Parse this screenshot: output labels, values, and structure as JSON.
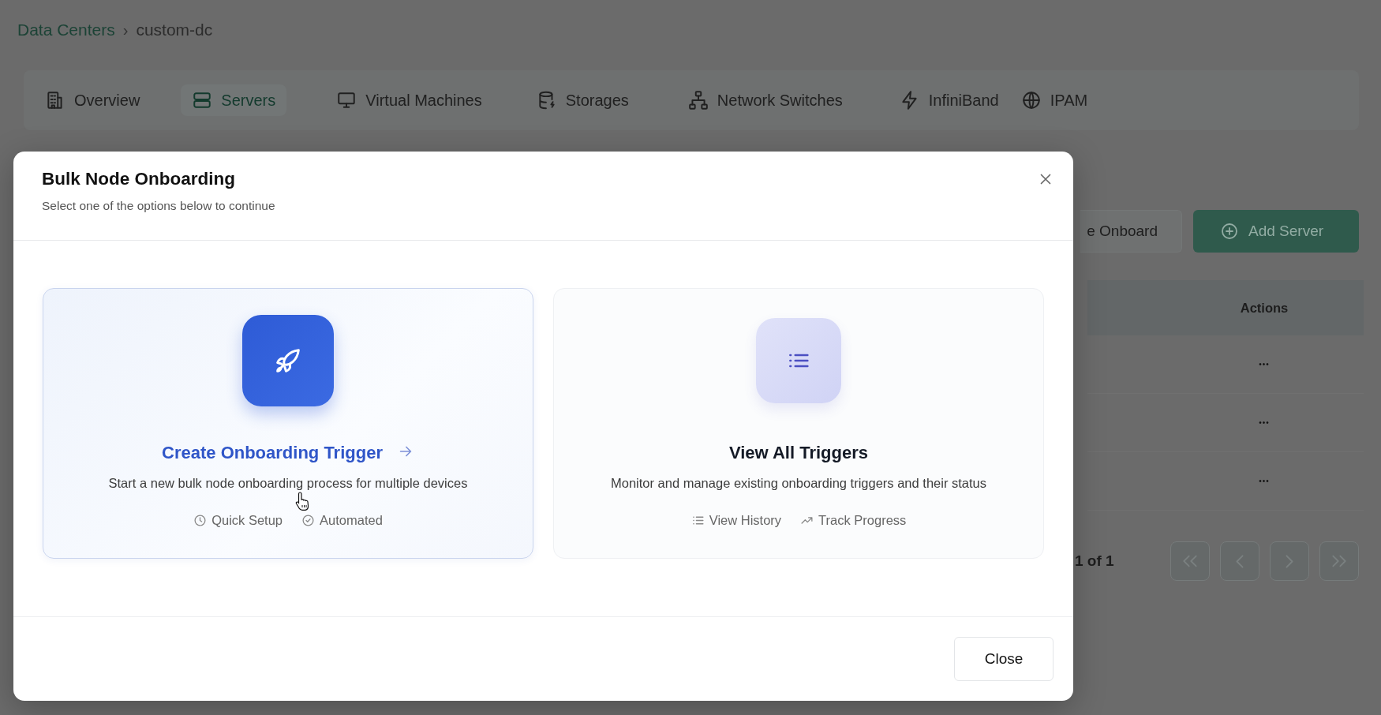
{
  "breadcrumb": {
    "items": [
      {
        "label": "Data Centers",
        "kind": "link"
      },
      {
        "label": "custom-dc",
        "kind": "current"
      }
    ],
    "separator": "›"
  },
  "tabs": [
    {
      "label": "Overview",
      "selected": false
    },
    {
      "label": "Servers",
      "selected": true
    },
    {
      "label": "Virtual Machines",
      "selected": false
    },
    {
      "label": "Storages",
      "selected": false
    },
    {
      "label": "Network Switches",
      "selected": false
    },
    {
      "label": "InfiniBand",
      "selected": false
    },
    {
      "label": "IPAM",
      "selected": false
    }
  ],
  "toolbar": {
    "buttons": [
      {
        "label": "e Onboard",
        "kind": "outline"
      },
      {
        "label": "Add Server",
        "kind": "primary"
      }
    ]
  },
  "table": {
    "columns": [
      "Actions"
    ],
    "rows": [
      {
        "actions": "•••"
      },
      {
        "actions": "•••"
      },
      {
        "actions": "•••"
      }
    ]
  },
  "pagination": {
    "page_info": "1 of 1",
    "buttons": [
      {
        "kind": "first",
        "disabled": true
      },
      {
        "kind": "prev",
        "disabled": true
      },
      {
        "kind": "next",
        "disabled": true
      },
      {
        "kind": "last",
        "disabled": true
      }
    ]
  },
  "modal": {
    "title": "Bulk Node Onboarding",
    "subtitle": "Select one of the options below to continue",
    "options": [
      {
        "kind": "create",
        "title": "Create Onboarding Trigger",
        "highlighted": true,
        "description": "Start a new bulk node onboarding process for multiple devices",
        "features": [
          "Quick Setup",
          "Automated"
        ]
      },
      {
        "kind": "view",
        "title": "View All Triggers",
        "highlighted": false,
        "description": "Monitor and manage existing onboarding triggers and their status",
        "features": [
          "View History",
          "Track Progress"
        ]
      }
    ],
    "close_button": "Close"
  }
}
